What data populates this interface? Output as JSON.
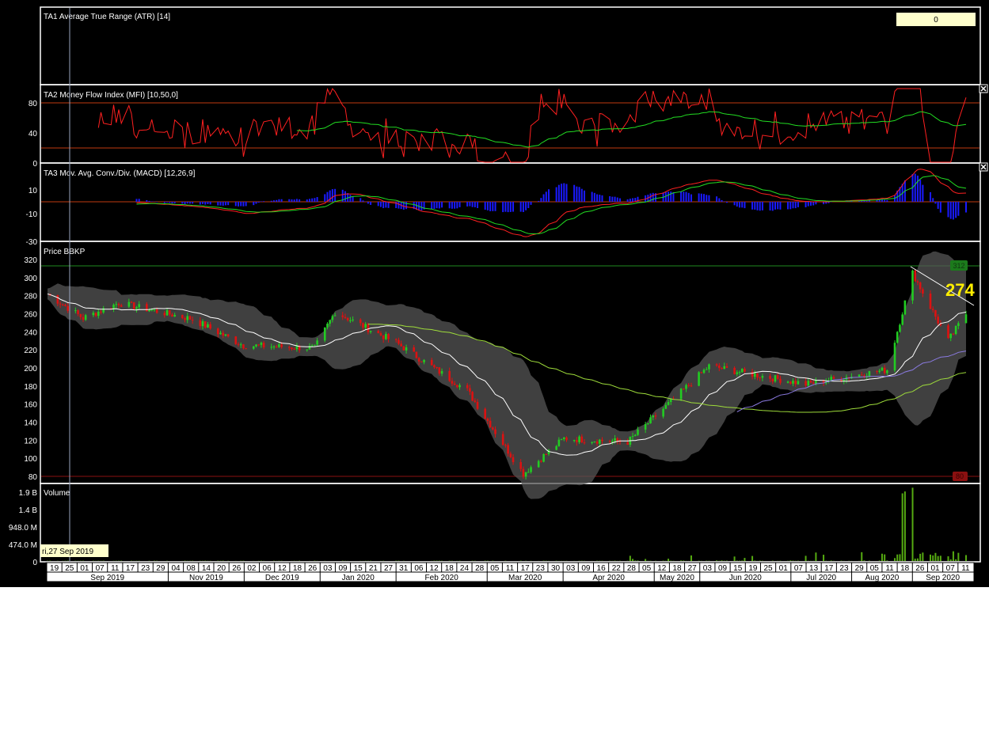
{
  "panels": {
    "atr": {
      "title": "TA1 Average True Range (ATR) [14]",
      "value_box": "0"
    },
    "mfi": {
      "title": "TA2 Money Flow Index (MFI) [10,50,0]",
      "ticks": [
        "80",
        "40",
        "0"
      ]
    },
    "macd": {
      "title": "TA3 Mov. Avg. Conv./Div. (MACD) [12,26,9]",
      "ticks": [
        "10",
        "-10",
        "-30"
      ]
    },
    "price": {
      "title": "Price BBKP",
      "ticks": [
        "320",
        "300",
        "280",
        "260",
        "240",
        "220",
        "200",
        "180",
        "160",
        "140",
        "120",
        "100",
        "80"
      ],
      "resistance_tag": "312",
      "support_tag": "80",
      "last_price": "274"
    },
    "volume": {
      "title": "Volume",
      "ticks": [
        "1.9 B",
        "1.4 B",
        "948.0 M",
        "474.0 M",
        "0"
      ]
    }
  },
  "cursor_date": "ri,27 Sep 2019",
  "time_axis": {
    "days": [
      "19",
      "25",
      "01",
      "07",
      "11",
      "17",
      "23",
      "29",
      "04",
      "08",
      "14",
      "20",
      "26",
      "02",
      "06",
      "12",
      "18",
      "26",
      "03",
      "09",
      "15",
      "21",
      "27",
      "31",
      "06",
      "12",
      "18",
      "24",
      "28",
      "05",
      "11",
      "17",
      "23",
      "30",
      "03",
      "09",
      "16",
      "22",
      "28",
      "05",
      "12",
      "18",
      "27",
      "03",
      "09",
      "15",
      "19",
      "25",
      "01",
      "07",
      "13",
      "17",
      "23",
      "29",
      "05",
      "11",
      "18",
      "26",
      "01",
      "07",
      "11"
    ],
    "months": [
      "Sep 2019",
      "Nov 2019",
      "Dec 2019",
      "Jan 2020",
      "Feb 2020",
      "Mar 2020",
      "Apr 2020",
      "May 2020",
      "Jun 2020",
      "Jul 2020",
      "Aug 2020",
      "Sep 2020"
    ]
  },
  "colors": {
    "background": "#000000",
    "up_candle": "#22cc22",
    "down_candle": "#dd1111",
    "mfi_line": "#ff2020",
    "mfi_signal": "#22dd22",
    "macd_line": "#ff2020",
    "macd_signal": "#22dd22",
    "macd_hist": "#1a1aff",
    "bollinger_band": "#555555",
    "volume_bar": "#55aa11",
    "last_price_label": "#ffee00"
  },
  "chart_data": {
    "type": "candlestick",
    "title": "Price BBKP",
    "x_range": [
      "2019-09-19",
      "2020-09-14"
    ],
    "ylim": [
      70,
      325
    ],
    "price_keypoints": [
      {
        "date": "2019-09-19",
        "close": 282
      },
      {
        "date": "2019-10-03",
        "close": 255
      },
      {
        "date": "2019-10-17",
        "close": 272
      },
      {
        "date": "2019-11-15",
        "close": 254
      },
      {
        "date": "2019-12-05",
        "close": 225
      },
      {
        "date": "2020-01-02",
        "close": 222
      },
      {
        "date": "2020-01-10",
        "close": 262
      },
      {
        "date": "2020-02-03",
        "close": 228
      },
      {
        "date": "2020-03-02",
        "close": 175
      },
      {
        "date": "2020-03-24",
        "close": 83
      },
      {
        "date": "2020-04-09",
        "close": 122
      },
      {
        "date": "2020-05-04",
        "close": 118
      },
      {
        "date": "2020-06-05",
        "close": 202
      },
      {
        "date": "2020-07-13",
        "close": 182
      },
      {
        "date": "2020-08-14",
        "close": 198
      },
      {
        "date": "2020-08-24",
        "close": 305
      },
      {
        "date": "2020-09-07",
        "close": 230
      },
      {
        "date": "2020-09-14",
        "close": 260
      }
    ],
    "horizontal_levels": [
      312,
      80
    ],
    "mfi_ylim": [
      0,
      100
    ],
    "mfi_levels": [
      80,
      20
    ],
    "macd_ylim": [
      -33,
      25
    ],
    "volume_ylim": [
      0,
      2000000000
    ],
    "volume_spikes": [
      {
        "date": "2020-08-20",
        "value": 1800000000
      },
      {
        "date": "2020-08-21",
        "value": 1850000000
      },
      {
        "date": "2020-08-24",
        "value": 1950000000
      }
    ],
    "grid": false
  }
}
